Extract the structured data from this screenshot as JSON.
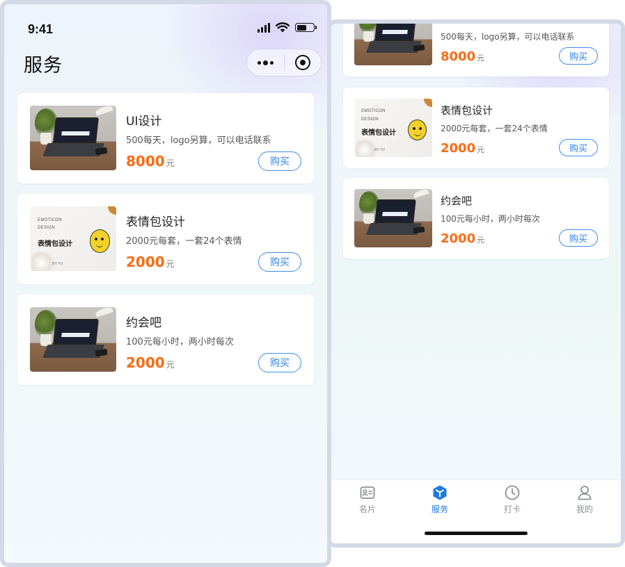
{
  "status_bar": {
    "time": "9:41"
  },
  "nav": {
    "title": "服务"
  },
  "services": [
    {
      "title": "UI设计",
      "desc": "500每天，logo另算，可以电话联系",
      "price": "8000",
      "unit": "元",
      "buy_label": "购买",
      "thumbnail": "laptop-mockup"
    },
    {
      "title": "表情包设计",
      "desc": "2000元每套，一套24个表情",
      "price": "2000",
      "unit": "元",
      "buy_label": "购买",
      "thumbnail": "emoticon-design",
      "thumb_text": {
        "en_line1": "EMOTICON",
        "en_line2": "DESIGN",
        "cn": "表情包设计",
        "credit": "BY YU"
      }
    },
    {
      "title": "约会吧",
      "desc": "100元每小时，两小时每次",
      "price": "2000",
      "unit": "元",
      "buy_label": "购买",
      "thumbnail": "laptop-mockup"
    }
  ],
  "tab_bar": {
    "items": [
      {
        "label": "名片",
        "icon": "card-icon",
        "active": false
      },
      {
        "label": "服务",
        "icon": "cube-icon",
        "active": true
      },
      {
        "label": "打卡",
        "icon": "clock-icon",
        "active": false
      },
      {
        "label": "我的",
        "icon": "user-icon",
        "active": false
      }
    ]
  },
  "colors": {
    "price": "#ff6a13",
    "accent": "#1f7ae0",
    "button_border": "#3b8df0",
    "frame": "#d3d9e6"
  }
}
